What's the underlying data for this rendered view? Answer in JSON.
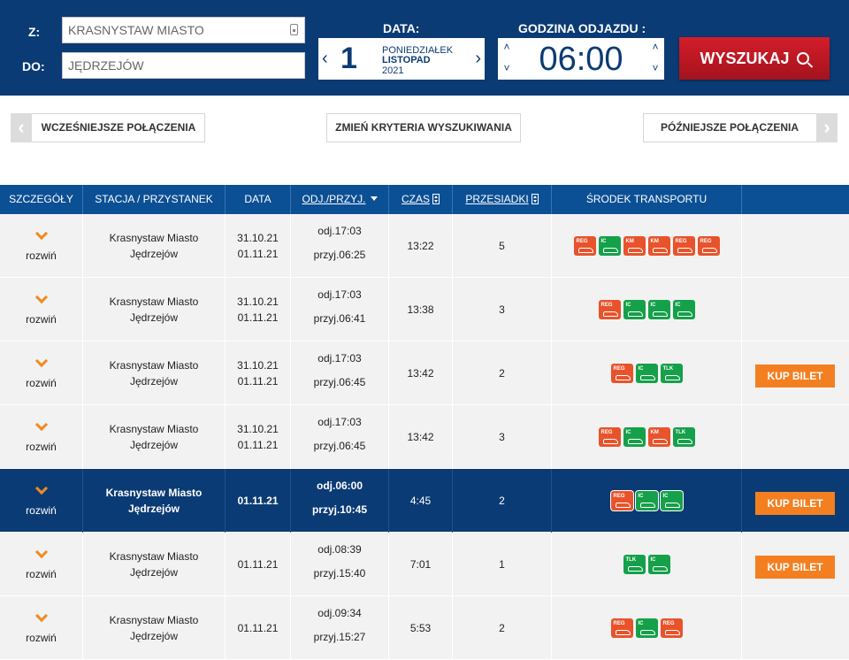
{
  "search": {
    "from_label": "Z:",
    "to_label": "DO:",
    "from_value": "KRASNYSTAW MIASTO",
    "to_value": "JĘDRZEJÓW",
    "date_title": "DATA:",
    "date_day": "1",
    "date_weekday": "PONIEDZIAŁEK",
    "date_month": "LISTOPAD",
    "date_year": "2021",
    "time_title": "GODZINA ODJAZDU :",
    "time_value": "06:00",
    "search_label": "WYSZUKAJ"
  },
  "nav": {
    "earlier_label": "WCZEŚNIEJSZE POŁĄCZENIA",
    "change_label": "ZMIEŃ KRYTERIA WYSZUKIWANIA",
    "later_label": "PÓŹNIEJSZE POŁĄCZENIA"
  },
  "table": {
    "headers": [
      "SZCZEGÓŁY",
      "STACJA / PRZYSTANEK",
      "DATA",
      "ODJ./PRZYJ.",
      "CZAS",
      "PRZESIADKI",
      "ŚRODEK TRANSPORTU"
    ],
    "expand_label": "rozwiń",
    "buy_label": "KUP BILET",
    "rows": [
      {
        "from": "Krasnystaw Miasto",
        "to": "Jędrzejów",
        "dep_date": "31.10.21",
        "arr_date": "01.11.21",
        "dep": "odj.17:03",
        "arr": "przyj.06:25",
        "duration": "13:22",
        "transfers": "5",
        "transport": [
          "REG",
          "IC",
          "KM",
          "KM",
          "REG",
          "REG"
        ],
        "buy": false,
        "highlight": false
      },
      {
        "from": "Krasnystaw Miasto",
        "to": "Jędrzejów",
        "dep_date": "31.10.21",
        "arr_date": "01.11.21",
        "dep": "odj.17:03",
        "arr": "przyj.06:41",
        "duration": "13:38",
        "transfers": "3",
        "transport": [
          "REG",
          "IC",
          "IC",
          "IC"
        ],
        "buy": false,
        "highlight": false
      },
      {
        "from": "Krasnystaw Miasto",
        "to": "Jędrzejów",
        "dep_date": "31.10.21",
        "arr_date": "01.11.21",
        "dep": "odj.17:03",
        "arr": "przyj.06:45",
        "duration": "13:42",
        "transfers": "2",
        "transport": [
          "REG",
          "IC",
          "TLK"
        ],
        "buy": true,
        "highlight": false
      },
      {
        "from": "Krasnystaw Miasto",
        "to": "Jędrzejów",
        "dep_date": "31.10.21",
        "arr_date": "01.11.21",
        "dep": "odj.17:03",
        "arr": "przyj.06:45",
        "duration": "13:42",
        "transfers": "3",
        "transport": [
          "REG",
          "IC",
          "KM",
          "TLK"
        ],
        "buy": false,
        "highlight": false
      },
      {
        "from": "Krasnystaw Miasto",
        "to": "Jędrzejów",
        "dep_date": "",
        "arr_date": "01.11.21",
        "dep": "odj.06:00",
        "arr": "przyj.10:45",
        "duration": "4:45",
        "transfers": "2",
        "transport": [
          "REG",
          "IC",
          "IC"
        ],
        "buy": true,
        "highlight": true
      },
      {
        "from": "Krasnystaw Miasto",
        "to": "Jędrzejów",
        "dep_date": "",
        "arr_date": "01.11.21",
        "dep": "odj.08:39",
        "arr": "przyj.15:40",
        "duration": "7:01",
        "transfers": "1",
        "transport": [
          "TLK",
          "IC"
        ],
        "buy": true,
        "highlight": false
      },
      {
        "from": "Krasnystaw Miasto",
        "to": "Jędrzejów",
        "dep_date": "",
        "arr_date": "01.11.21",
        "dep": "odj.09:34",
        "arr": "przyj.15:27",
        "duration": "5:53",
        "transfers": "2",
        "transport": [
          "REG",
          "IC",
          "REG"
        ],
        "buy": false,
        "highlight": false
      }
    ]
  },
  "colors": {
    "header_bg": "#0b3b74",
    "table_header_bg": "#0b4f94",
    "search_button": "#c4192a",
    "buy_button": "#f47f20",
    "expand_chevron": "#f08a24",
    "badge_regional": "#e8532b",
    "badge_intercity": "#15a04a"
  },
  "icons": {
    "station_field": "station-board-icon",
    "search_button": "magnifier-icon",
    "expand": "chevron-down-icon",
    "prev": "chevron-left-icon",
    "next": "chevron-right-icon"
  }
}
